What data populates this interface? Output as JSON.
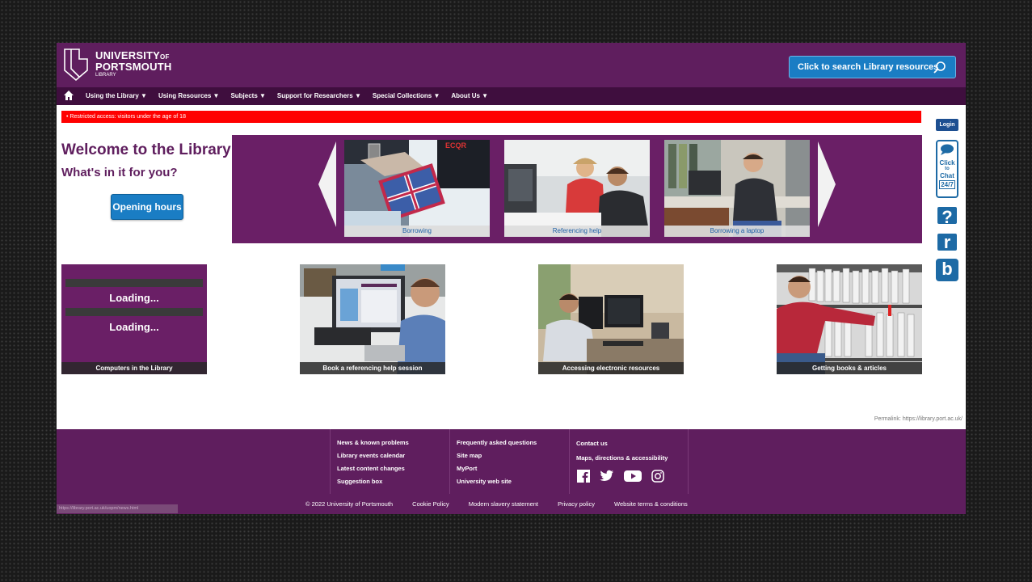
{
  "header": {
    "logo_line1": "UNIVERSITY",
    "logo_of": "OF",
    "logo_line2": "PORTSMOUTH",
    "logo_sub": "LIBRARY",
    "search_button": "Click to search Library resources"
  },
  "nav": {
    "items": [
      {
        "label": "Using the Library ▼"
      },
      {
        "label": "Using Resources ▼"
      },
      {
        "label": "Subjects ▼"
      },
      {
        "label": "Support for Researchers ▼"
      },
      {
        "label": "Special Collections ▼"
      },
      {
        "label": "About Us ▼"
      }
    ]
  },
  "alert": "• Restricted access: visitors under the age of 18",
  "sidebar": {
    "login": "Login",
    "chat": [
      "Click",
      "to",
      "Chat",
      "24/7"
    ],
    "help": "?",
    "r": "r",
    "b": "b"
  },
  "welcome": {
    "title": "Welcome to the Library",
    "subtitle": "What's in it for you?",
    "opening_hours": "Opening hours"
  },
  "carousel": {
    "slides": [
      {
        "caption": "Borrowing"
      },
      {
        "caption": "Referencing help"
      },
      {
        "caption": "Borrowing a laptop"
      }
    ]
  },
  "tiles": {
    "computers": {
      "loading1": "Loading...",
      "loading2": "Loading...",
      "caption": "Computers in the Library"
    },
    "items": [
      {
        "caption": "Book a referencing help session"
      },
      {
        "caption": "Accessing electronic resources"
      },
      {
        "caption": "Getting books & articles"
      }
    ]
  },
  "permalink": "Permalink: https://library.port.ac.uk/",
  "footer": {
    "col1": [
      "News & known problems",
      "Library events calendar",
      "Latest content changes",
      "Suggestion box"
    ],
    "col2": [
      "Frequently asked questions",
      "Site map",
      "MyPort",
      "University web site"
    ],
    "col3": [
      "Contact us",
      "Maps, directions & accessibility"
    ]
  },
  "bottom": {
    "copyright": "© 2022 University of Portsmouth",
    "links": [
      "Cookie Policy",
      "Modern slavery statement",
      "Privacy policy",
      "Website terms & conditions"
    ]
  },
  "status_url": "https://library.port.ac.uk/uopm/news.html",
  "colors": {
    "purple": "#5f1e5e",
    "dark_purple": "#3f0e3e",
    "blue": "#1a7dc4",
    "alert_red": "#ff0000"
  }
}
